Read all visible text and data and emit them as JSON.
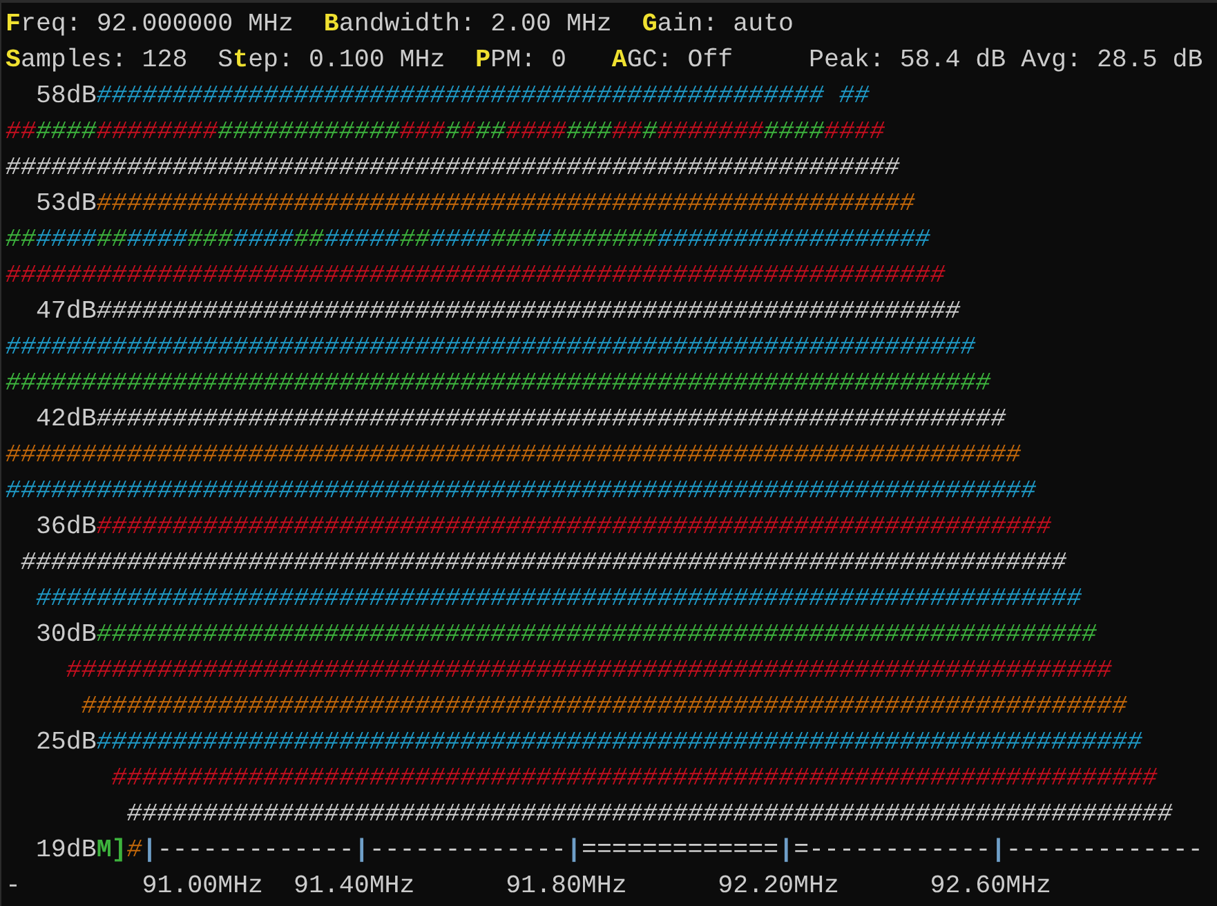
{
  "terminal": {
    "lines": [
      {
        "segments": [
          {
            "kind": "hotkey",
            "text": "F",
            "color": "#f0e130"
          },
          {
            "kind": "text",
            "text": "req: 92.000000 MHz  ",
            "color": "#cccccc"
          },
          {
            "kind": "hotkey",
            "text": "B",
            "color": "#f0e130"
          },
          {
            "kind": "text",
            "text": "andwidth: 2.00 MHz  ",
            "color": "#cccccc"
          },
          {
            "kind": "hotkey",
            "text": "G",
            "color": "#f0e130"
          },
          {
            "kind": "text",
            "text": "ain: auto",
            "color": "#cccccc"
          }
        ]
      },
      {
        "segments": [
          {
            "kind": "hotkey",
            "text": "S",
            "color": "#f0e130"
          },
          {
            "kind": "text",
            "text": "amples: 128  S",
            "color": "#cccccc"
          },
          {
            "kind": "hotkey",
            "text": "t",
            "color": "#f0e130"
          },
          {
            "kind": "text",
            "text": "ep: 0.100 MHz  ",
            "color": "#cccccc"
          },
          {
            "kind": "hotkey",
            "text": "P",
            "color": "#f0e130"
          },
          {
            "kind": "text",
            "text": "PM: 0   ",
            "color": "#cccccc"
          },
          {
            "kind": "hotkey",
            "text": "A",
            "color": "#f0e130"
          },
          {
            "kind": "text",
            "text": "GC: Off     Peak: 58.4 dB Avg: 28.5 dB",
            "color": "#cccccc"
          }
        ]
      },
      {
        "segments": [
          {
            "kind": "label",
            "text": "  58dB",
            "color": "#cccccc"
          },
          {
            "kind": "bar",
            "text": "################################################ ##",
            "color": "#1f9ac7"
          }
        ]
      },
      {
        "segments": [
          {
            "kind": "bar",
            "text": "##",
            "color": "#c50f1f"
          },
          {
            "kind": "bar",
            "text": "####",
            "color": "#3db33d"
          },
          {
            "kind": "bar",
            "text": "########",
            "color": "#c50f1f"
          },
          {
            "kind": "bar",
            "text": "############",
            "color": "#3db33d"
          },
          {
            "kind": "bar",
            "text": "###",
            "color": "#c50f1f"
          },
          {
            "kind": "bar",
            "text": "#",
            "color": "#3db33d"
          },
          {
            "kind": "bar",
            "text": "#",
            "color": "#c50f1f"
          },
          {
            "kind": "bar",
            "text": "##",
            "color": "#3db33d"
          },
          {
            "kind": "bar",
            "text": "####",
            "color": "#c50f1f"
          },
          {
            "kind": "bar",
            "text": "###",
            "color": "#3db33d"
          },
          {
            "kind": "bar",
            "text": "##",
            "color": "#c50f1f"
          },
          {
            "kind": "bar",
            "text": "#",
            "color": "#3db33d"
          },
          {
            "kind": "bar",
            "text": "#######",
            "color": "#c50f1f"
          },
          {
            "kind": "bar",
            "text": "####",
            "color": "#3db33d"
          },
          {
            "kind": "bar",
            "text": "####",
            "color": "#c50f1f"
          }
        ]
      },
      {
        "segments": [
          {
            "kind": "bar",
            "text": "###########################################################",
            "color": "#cccccc"
          }
        ]
      },
      {
        "segments": [
          {
            "kind": "label",
            "text": "  53dB",
            "color": "#cccccc"
          },
          {
            "kind": "bar",
            "text": "######################################################",
            "color": "#c4680a"
          }
        ]
      },
      {
        "segments": [
          {
            "kind": "bar",
            "text": "##",
            "color": "#3db33d"
          },
          {
            "kind": "bar",
            "text": "####",
            "color": "#1f9ac7"
          },
          {
            "kind": "bar",
            "text": "##",
            "color": "#3db33d"
          },
          {
            "kind": "bar",
            "text": "####",
            "color": "#1f9ac7"
          },
          {
            "kind": "bar",
            "text": "###",
            "color": "#3db33d"
          },
          {
            "kind": "bar",
            "text": "####",
            "color": "#1f9ac7"
          },
          {
            "kind": "bar",
            "text": "##",
            "color": "#3db33d"
          },
          {
            "kind": "bar",
            "text": "#####",
            "color": "#1f9ac7"
          },
          {
            "kind": "bar",
            "text": "##",
            "color": "#3db33d"
          },
          {
            "kind": "bar",
            "text": "####",
            "color": "#1f9ac7"
          },
          {
            "kind": "bar",
            "text": "###",
            "color": "#3db33d"
          },
          {
            "kind": "bar",
            "text": "#",
            "color": "#1f9ac7"
          },
          {
            "kind": "bar",
            "text": "#######",
            "color": "#3db33d"
          },
          {
            "kind": "bar",
            "text": "##################",
            "color": "#1f9ac7"
          }
        ]
      },
      {
        "segments": [
          {
            "kind": "bar",
            "text": "##############################################################",
            "color": "#c50f1f"
          }
        ]
      },
      {
        "segments": [
          {
            "kind": "label",
            "text": "  47dB",
            "color": "#cccccc"
          },
          {
            "kind": "bar",
            "text": "#########################################################",
            "color": "#cccccc"
          }
        ]
      },
      {
        "segments": [
          {
            "kind": "bar",
            "text": "################################################################",
            "color": "#1f9ac7"
          }
        ]
      },
      {
        "segments": [
          {
            "kind": "bar",
            "text": "#################################################################",
            "color": "#3db33d"
          }
        ]
      },
      {
        "segments": [
          {
            "kind": "label",
            "text": "  42dB",
            "color": "#cccccc"
          },
          {
            "kind": "bar",
            "text": "############################################################",
            "color": "#cccccc"
          }
        ]
      },
      {
        "segments": [
          {
            "kind": "bar",
            "text": "###################################################################",
            "color": "#c4680a"
          }
        ]
      },
      {
        "segments": [
          {
            "kind": "bar",
            "text": "####################################################################",
            "color": "#1f9ac7"
          }
        ]
      },
      {
        "segments": [
          {
            "kind": "label",
            "text": "  36dB",
            "color": "#cccccc"
          },
          {
            "kind": "bar",
            "text": "###############################################################",
            "color": "#c50f1f"
          }
        ]
      },
      {
        "segments": [
          {
            "kind": "bar",
            "text": " #####################################################################",
            "color": "#cccccc"
          }
        ]
      },
      {
        "segments": [
          {
            "kind": "bar",
            "text": "  #####################################################################",
            "color": "#1f9ac7"
          }
        ]
      },
      {
        "segments": [
          {
            "kind": "label",
            "text": "  30dB",
            "color": "#cccccc"
          },
          {
            "kind": "bar",
            "text": "##################################################################",
            "color": "#3db33d"
          }
        ]
      },
      {
        "segments": [
          {
            "kind": "bar",
            "text": "    #####################################################################",
            "color": "#c50f1f"
          }
        ]
      },
      {
        "segments": [
          {
            "kind": "bar",
            "text": "     #####################################################################",
            "color": "#c4680a"
          }
        ]
      },
      {
        "segments": [
          {
            "kind": "label",
            "text": "  25dB",
            "color": "#cccccc"
          },
          {
            "kind": "bar",
            "text": "#####################################################################",
            "color": "#1f9ac7"
          }
        ]
      },
      {
        "segments": [
          {
            "kind": "bar",
            "text": "       #####################################################################",
            "color": "#c50f1f"
          }
        ]
      },
      {
        "segments": [
          {
            "kind": "bar",
            "text": "        #####################################################################",
            "color": "#cccccc"
          }
        ]
      },
      {
        "segments": [
          {
            "kind": "label",
            "text": "  19dB",
            "color": "#cccccc"
          },
          {
            "kind": "marker",
            "text": "M]",
            "color": "#3db33d"
          },
          {
            "kind": "bar",
            "text": "#",
            "color": "#c4680a"
          },
          {
            "kind": "tick",
            "text": "|",
            "color": "#6f9fc8"
          },
          {
            "kind": "axis",
            "text": "-------------",
            "color": "#cccccc"
          },
          {
            "kind": "tick",
            "text": "|",
            "color": "#6f9fc8"
          },
          {
            "kind": "axis",
            "text": "-------------",
            "color": "#cccccc"
          },
          {
            "kind": "tick",
            "text": "|",
            "color": "#6f9fc8"
          },
          {
            "kind": "axis",
            "text": "=============",
            "color": "#cccccc"
          },
          {
            "kind": "tick",
            "text": "|",
            "color": "#6f9fc8"
          },
          {
            "kind": "axis",
            "text": "=------------",
            "color": "#cccccc"
          },
          {
            "kind": "tick",
            "text": "|",
            "color": "#6f9fc8"
          },
          {
            "kind": "axis",
            "text": "-------------",
            "color": "#cccccc"
          }
        ]
      },
      {
        "segments": [
          {
            "kind": "axis",
            "text": "-        ",
            "color": "#cccccc"
          },
          {
            "kind": "scale",
            "text": "91.00MHz  ",
            "color": "#cccccc"
          },
          {
            "kind": "scale",
            "text": "91.40MHz      ",
            "color": "#cccccc"
          },
          {
            "kind": "scale",
            "text": "91.80MHz      ",
            "color": "#cccccc"
          },
          {
            "kind": "scale",
            "text": "92.20MHz      ",
            "color": "#cccccc"
          },
          {
            "kind": "scale",
            "text": "92.60MHz",
            "color": "#cccccc"
          }
        ]
      }
    ]
  }
}
